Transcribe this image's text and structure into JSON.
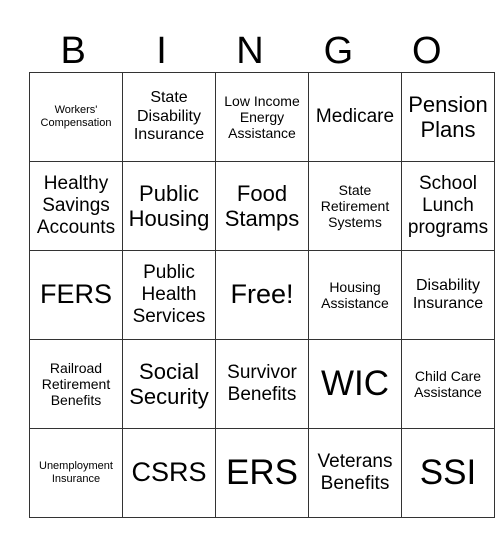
{
  "title_letters": [
    "B",
    "I",
    "N",
    "G",
    "O"
  ],
  "cells": [
    [
      "Workers' Compensation",
      "State Disability Insurance",
      "Low Income Energy Assistance",
      "Medicare",
      "Pension Plans"
    ],
    [
      "Healthy Savings Accounts",
      "Public Housing",
      "Food Stamps",
      "State Retirement Systems",
      "School Lunch programs"
    ],
    [
      "FERS",
      "Public Health Services",
      "Free!",
      "Housing Assistance",
      "Disability Insurance"
    ],
    [
      "Railroad Retirement Benefits",
      "Social Security",
      "Survivor Benefits",
      "WIC",
      "Child Care Assistance"
    ],
    [
      "Unemployment Insurance",
      "CSRS",
      "ERS",
      "Veterans Benefits",
      "SSI"
    ]
  ]
}
